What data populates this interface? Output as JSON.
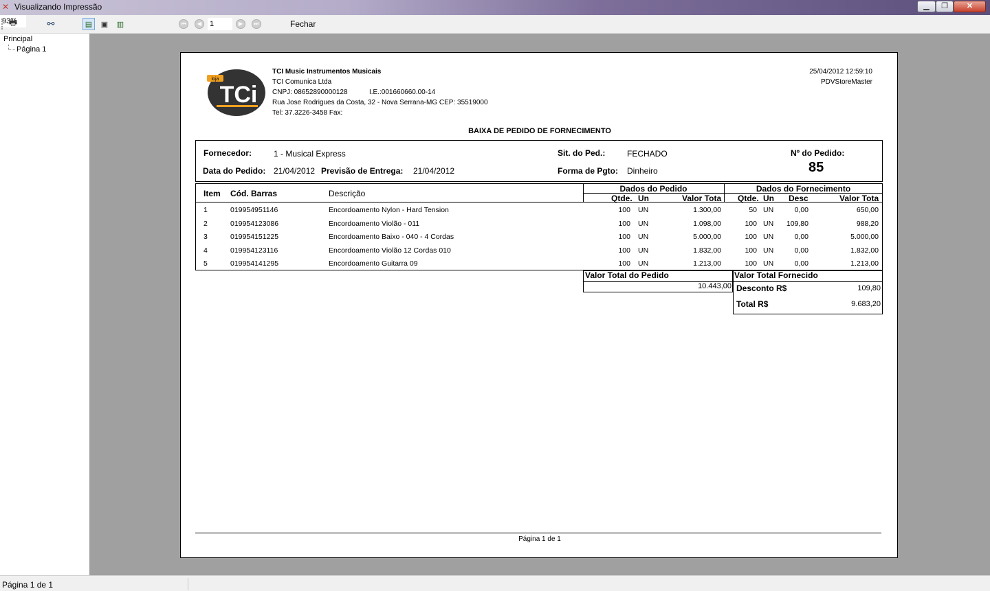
{
  "window": {
    "title": "Visualizando Impressão",
    "icon": "app-icon",
    "controls": {
      "minimize": "minimize-icon",
      "maximize": "maximize-icon",
      "close": "close-icon"
    }
  },
  "toolbar": {
    "zoom": "93%",
    "page_number": "1",
    "close_label": "Fechar"
  },
  "tree": {
    "root": "Principal",
    "child": "Página 1"
  },
  "status": {
    "text": "Página 1 de 1"
  },
  "report": {
    "company": {
      "name": "TCI Music Instrumentos Musicais",
      "legal_name": "TCI Comunica Ltda",
      "cnpj": "CNPJ: 08652890000128",
      "ie": "I.E.:001660660.00-14",
      "address": "Rua Jose Rodrigues da Costa, 32 - Nova Serrana-MG CEP: 35519000",
      "phone": "Tel: 37.3226-3458 Fax:",
      "logo_text": "TCi",
      "logo_tag": "loja"
    },
    "datetime": "25/04/2012 12:59:10",
    "system": "PDVStoreMaster",
    "title": "BAIXA DE PEDIDO DE FORNECIMENTO",
    "header": {
      "fornecedor_label": "Fornecedor:",
      "fornecedor": "1 - Musical Express",
      "situacao_label": "Sit. do Ped.:",
      "situacao": "FECHADO",
      "pedido_no_label": "Nº do Pedido:",
      "pedido_no": "85",
      "data_label": "Data do Pedido:",
      "data": "21/04/2012",
      "previsao_label": "Previsão de Entrega:",
      "previsao": "21/04/2012",
      "pgto_label": "Forma de Pgto:",
      "pgto": "Dinheiro"
    },
    "table": {
      "col_item": "Item",
      "col_barras": "Cód. Barras",
      "col_descricao": "Descrição",
      "group_pedido": "Dados do Pedido",
      "group_fornecimento": "Dados do Fornecimento",
      "col_qtde": "Qtde.",
      "col_un": "Un",
      "col_valor": "Valor Tota",
      "col_desc": "Desc",
      "rows": [
        {
          "item": "1",
          "barras": "019954951146",
          "descricao": "Encordoamento Nylon - Hard Tension",
          "qtde": "100",
          "un": "UN",
          "valor": "1.300,00",
          "f_qtde": "50",
          "f_un": "UN",
          "f_desc": "0,00",
          "f_valor": "650,00"
        },
        {
          "item": "2",
          "barras": "019954123086",
          "descricao": "Encordoamento Violão - 011",
          "qtde": "100",
          "un": "UN",
          "valor": "1.098,00",
          "f_qtde": "100",
          "f_un": "UN",
          "f_desc": "109,80",
          "f_valor": "988,20"
        },
        {
          "item": "3",
          "barras": "019954151225",
          "descricao": "Encordoamento Baixo - 040 - 4 Cordas",
          "qtde": "100",
          "un": "UN",
          "valor": "5.000,00",
          "f_qtde": "100",
          "f_un": "UN",
          "f_desc": "0,00",
          "f_valor": "5.000,00"
        },
        {
          "item": "4",
          "barras": "019954123116",
          "descricao": "Encordoamento Violão 12 Cordas  010",
          "qtde": "100",
          "un": "UN",
          "valor": "1.832,00",
          "f_qtde": "100",
          "f_un": "UN",
          "f_desc": "0,00",
          "f_valor": "1.832,00"
        },
        {
          "item": "5",
          "barras": "019954141295",
          "descricao": "Encordoamento Guitarra 09",
          "qtde": "100",
          "un": "UN",
          "valor": "1.213,00",
          "f_qtde": "100",
          "f_un": "UN",
          "f_desc": "0,00",
          "f_valor": "1.213,00"
        }
      ]
    },
    "totals": {
      "pedido_label": "Valor Total do Pedido",
      "pedido_value": "10.443,00",
      "fornecido_label": "Valor Total Fornecido",
      "desconto_label": "Desconto R$",
      "desconto_value": "109,80",
      "total_label": "Total R$",
      "total_value": "9.683,20"
    },
    "footer": "Página 1 de 1"
  }
}
